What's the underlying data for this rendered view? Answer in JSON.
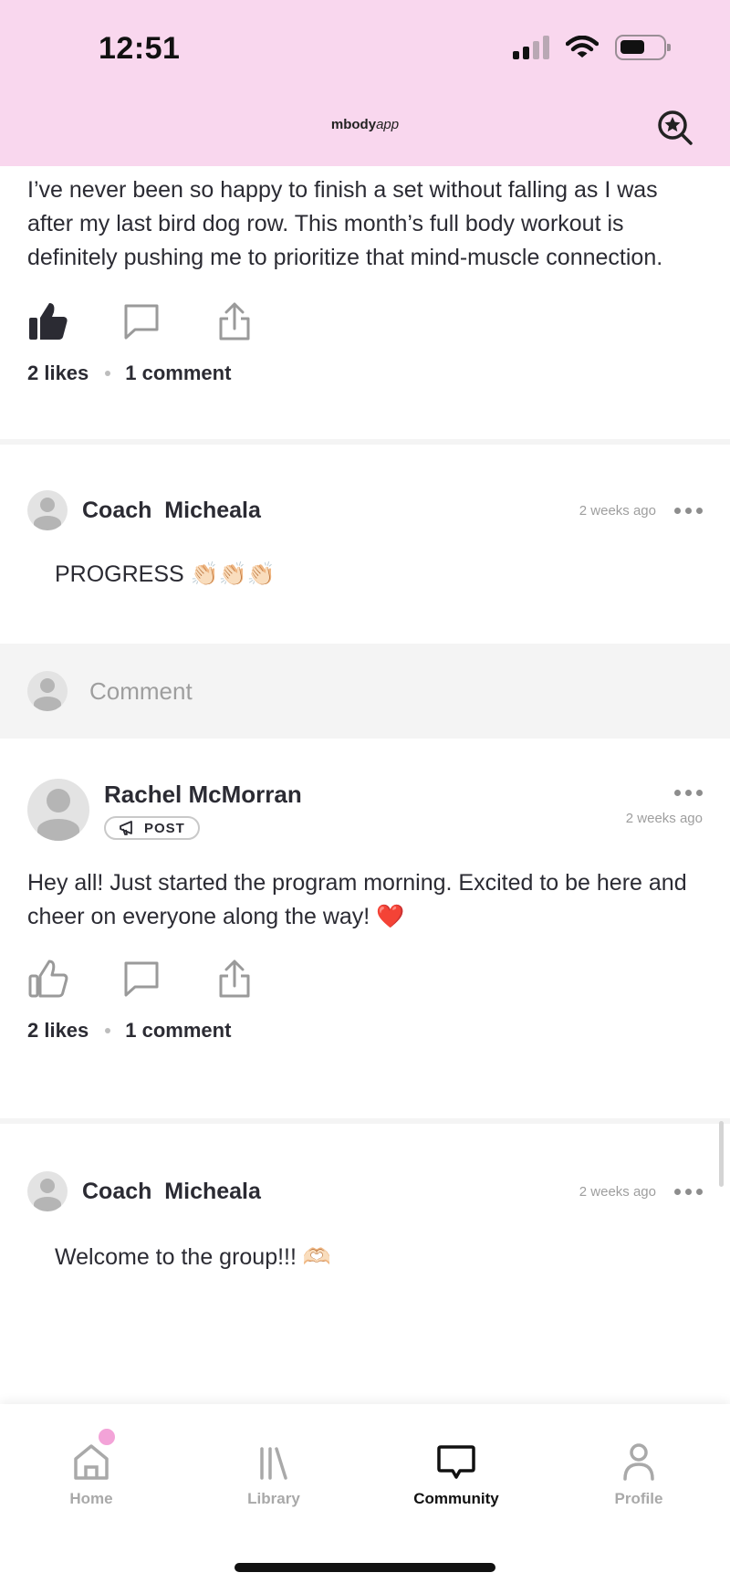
{
  "status_bar": {
    "time": "12:51"
  },
  "header": {
    "logo_prefix": "mbody",
    "logo_suffix": "app",
    "search_icon": "star-search-icon"
  },
  "posts": [
    {
      "text": "I’ve never been so happy to finish a set without falling as I was after my last bird dog row. This month’s full body workout is definitely pushing me to prioritize that mind-muscle connection.",
      "liked": true,
      "likes": "2 likes",
      "comments": "1 comment",
      "reply": {
        "name": "Coach  Micheala",
        "time": "2 weeks ago",
        "text": "PROGRESS 👏🏻👏🏻👏🏻"
      }
    },
    {
      "author": "Rachel McMorran",
      "tag": "POST",
      "time": "2 weeks ago",
      "text": "Hey all!  Just started the program morning.  Excited to be here and cheer on everyone along the way!  ❤️",
      "liked": false,
      "likes": "2 likes",
      "comments": "1 comment",
      "reply": {
        "name": "Coach  Micheala",
        "time": "2 weeks ago",
        "text": "Welcome to the group!!! 🫶🏻"
      }
    }
  ],
  "comment_placeholder": "Comment",
  "tabs": [
    {
      "label": "Home",
      "icon": "home-icon"
    },
    {
      "label": "Library",
      "icon": "library-icon"
    },
    {
      "label": "Community",
      "icon": "community-chat-icon"
    },
    {
      "label": "Profile",
      "icon": "profile-icon"
    }
  ],
  "colors": {
    "header_bg": "#f9d7ee",
    "accent": "#f3a3d8",
    "text": "#2b2b33"
  }
}
